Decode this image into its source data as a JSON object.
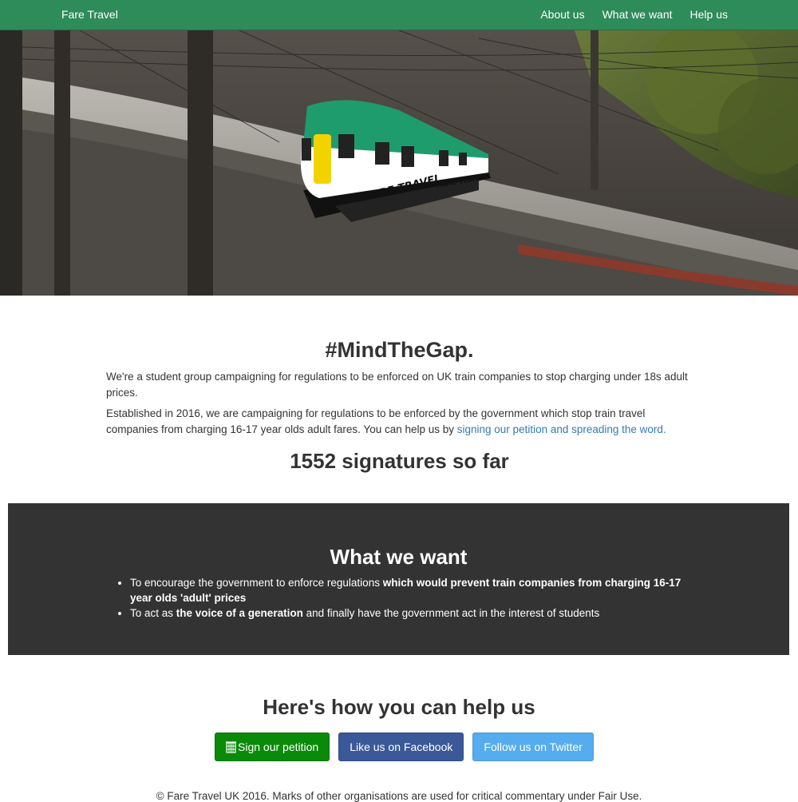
{
  "nav": {
    "brand": "Fare Travel",
    "links": [
      "About us",
      "What we want",
      "Help us"
    ]
  },
  "hero": {
    "logo_text": "FARE TRAVEL"
  },
  "intro": {
    "title": "#MindTheGap.",
    "para1": "We're a student group campaigning for regulations to be enforced on UK train companies to stop charging under 18s adult prices.",
    "para2_text": "Established in 2016, we are campaigning for regulations to be enforced by the government which stop train travel companies from charging 16-17 year olds adult fares. You can help us by ",
    "para2_link": "signing our petition and spreading the word.",
    "signatures": "1552 signatures so far"
  },
  "want": {
    "title": "What we want",
    "item1_pre": "To encourage the government to enforce regulations ",
    "item1_bold": "which would prevent train companies from charging 16-17 year olds 'adult' prices",
    "item2_pre": "To act as ",
    "item2_bold": "the voice of a generation",
    "item2_post": " and finally have the government act in the interest of students"
  },
  "help": {
    "title": "Here's how you can help us",
    "petition_label": "Sign our petition",
    "facebook_label": "Like us on Facebook",
    "twitter_label": "Follow us on Twitter"
  },
  "footer": {
    "text": "© Fare Travel UK 2016. Marks of other organisations are used for critical commentary under Fair Use."
  },
  "colors": {
    "nav": "#2e8b5a",
    "dark_section": "#333333",
    "petition": "#0a8a0a",
    "facebook": "#3b5998",
    "twitter": "#55acee",
    "link": "#337ab7"
  },
  "icons": {
    "petition": "portcullis-icon"
  }
}
